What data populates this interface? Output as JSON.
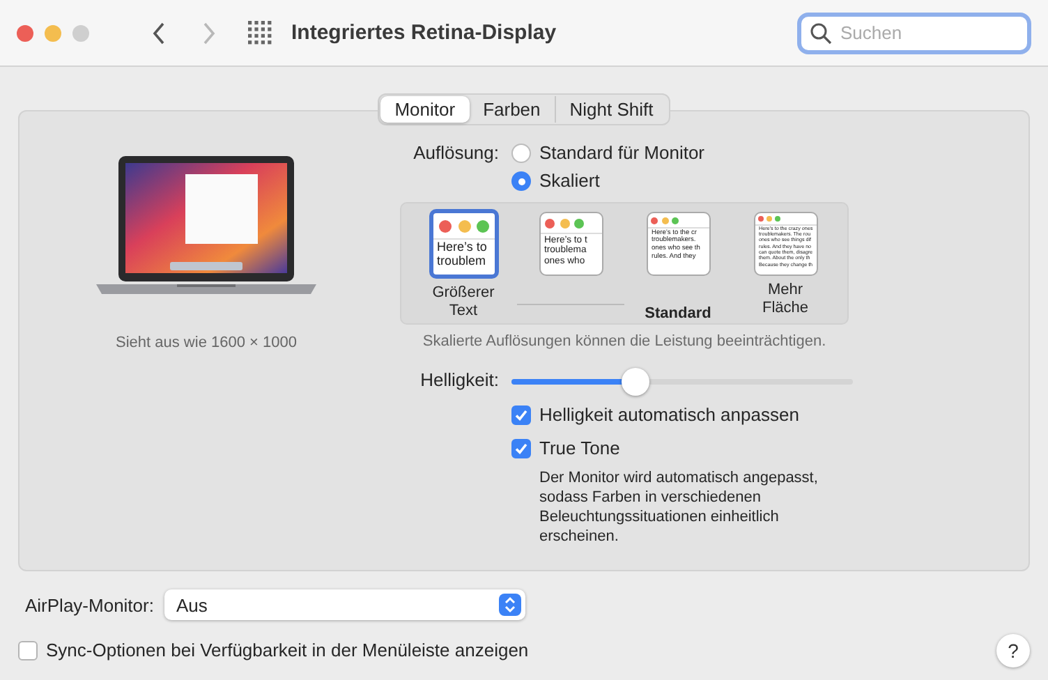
{
  "window": {
    "title": "Integriertes Retina-Display"
  },
  "search": {
    "placeholder": "Suchen",
    "focused": true
  },
  "tabs": [
    {
      "label": "Monitor",
      "selected": true
    },
    {
      "label": "Farben",
      "selected": false
    },
    {
      "label": "Night Shift",
      "selected": false
    }
  ],
  "display": {
    "caption": "Sieht aus wie 1600 × 1000"
  },
  "resolution": {
    "label": "Auflösung:",
    "options": [
      {
        "label": "Standard für Monitor",
        "selected": false
      },
      {
        "label": "Skaliert",
        "selected": true
      }
    ]
  },
  "scales": [
    {
      "label": "Größerer Text",
      "selected": true,
      "kind": "plain",
      "preview": [
        "Here’s to",
        "troublem"
      ]
    },
    {
      "selected": false,
      "kind": "plain",
      "preview": [
        "Here’s to t",
        "troublema",
        "ones who"
      ]
    },
    {
      "label": "Standard",
      "selected": false,
      "kind": "default",
      "preview": [
        "Here’s to the cr",
        "troublemakers.",
        "ones who see th",
        "rules. And they"
      ]
    },
    {
      "label": "Mehr Fläche",
      "selected": false,
      "kind": "plain",
      "preview": [
        "Here’s to the crazy ones",
        "troublemakers. The rou",
        "ones who see things dif",
        "rules. And they have no",
        "can quote them, disagre",
        "them. About the only th",
        "Because they change th"
      ]
    }
  ],
  "scale_note": "Skalierte Auflösungen können die Leistung beeinträchtigen.",
  "brightness": {
    "label": "Helligkeit:",
    "level": 0.35
  },
  "checkboxes": [
    {
      "label": "Helligkeit automatisch anpassen",
      "checked": true
    },
    {
      "label": "True Tone",
      "checked": true,
      "description": "Der Monitor wird automatisch angepasst, sodass Farben in verschiedenen Beleuchtungssituationen einheitlich erscheinen."
    }
  ],
  "airplay": {
    "label": "AirPlay-Monitor:",
    "value": "Aus"
  },
  "sync": {
    "label": "Sync-Optionen bei Verfügbarkeit in der Menüleiste anzeigen",
    "checked": false
  },
  "help": "?"
}
